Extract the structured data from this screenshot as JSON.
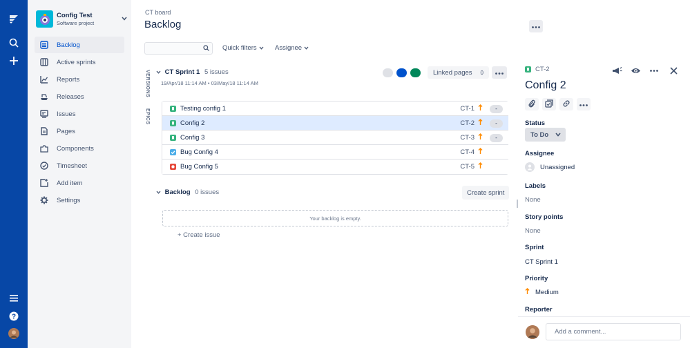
{
  "project": {
    "name": "Config Test",
    "type": "Software project"
  },
  "sidebar": {
    "items": [
      {
        "label": "Backlog",
        "icon": "backlog-icon"
      },
      {
        "label": "Active sprints",
        "icon": "board-icon"
      },
      {
        "label": "Reports",
        "icon": "chart-icon"
      },
      {
        "label": "Releases",
        "icon": "ship-icon"
      },
      {
        "label": "Issues",
        "icon": "issues-icon"
      },
      {
        "label": "Pages",
        "icon": "page-icon"
      },
      {
        "label": "Components",
        "icon": "component-icon"
      },
      {
        "label": "Timesheet",
        "icon": "clock-icon"
      },
      {
        "label": "Add item",
        "icon": "add-item-icon"
      },
      {
        "label": "Settings",
        "icon": "gear-icon"
      }
    ]
  },
  "header": {
    "breadcrumb": "CT board",
    "title": "Backlog"
  },
  "filters": {
    "quick": "Quick filters",
    "assignee": "Assignee"
  },
  "side_labels": {
    "versions": "VERSIONS",
    "epics": "EPICS"
  },
  "sprint": {
    "name": "CT Sprint 1",
    "count": "5 issues",
    "start": "19/Apr/18 11:14 AM",
    "sep": "•",
    "end": "03/May/18 11:14 AM",
    "linked_label": "Linked pages",
    "linked_count": "0",
    "status_colors": [
      "#dfe1e6",
      "#0052cc",
      "#00875a"
    ]
  },
  "issues": [
    {
      "summary": "Testing config 1",
      "key": "CT-1",
      "type": "story",
      "estimate": "-"
    },
    {
      "summary": "Config 2",
      "key": "CT-2",
      "type": "story",
      "estimate": "-"
    },
    {
      "summary": "Config 3",
      "key": "CT-3",
      "type": "story",
      "estimate": "-"
    },
    {
      "summary": "Bug Config 4",
      "key": "CT-4",
      "type": "task",
      "estimate": ""
    },
    {
      "summary": "Bug Config 5",
      "key": "CT-5",
      "type": "bug",
      "estimate": ""
    }
  ],
  "backlog": {
    "title": "Backlog",
    "count": "0 issues",
    "create_sprint": "Create sprint",
    "empty": "Your backlog is empty.",
    "create_issue": "+ Create issue"
  },
  "detail": {
    "key": "CT-2",
    "title": "Config 2",
    "status_label": "Status",
    "status": "To Do",
    "assignee_label": "Assignee",
    "assignee": "Unassigned",
    "labels_label": "Labels",
    "labels": "None",
    "story_points_label": "Story points",
    "story_points": "None",
    "sprint_label": "Sprint",
    "sprint": "CT Sprint 1",
    "priority_label": "Priority",
    "priority": "Medium",
    "reporter_label": "Reporter"
  },
  "comment": {
    "placeholder": "Add a comment..."
  },
  "colors": {
    "global_nav": "#0747a6",
    "accent": "#0052cc",
    "story": "#36b37e",
    "task": "#4bade8",
    "bug": "#e5493a",
    "priority": "#ff8b00"
  }
}
